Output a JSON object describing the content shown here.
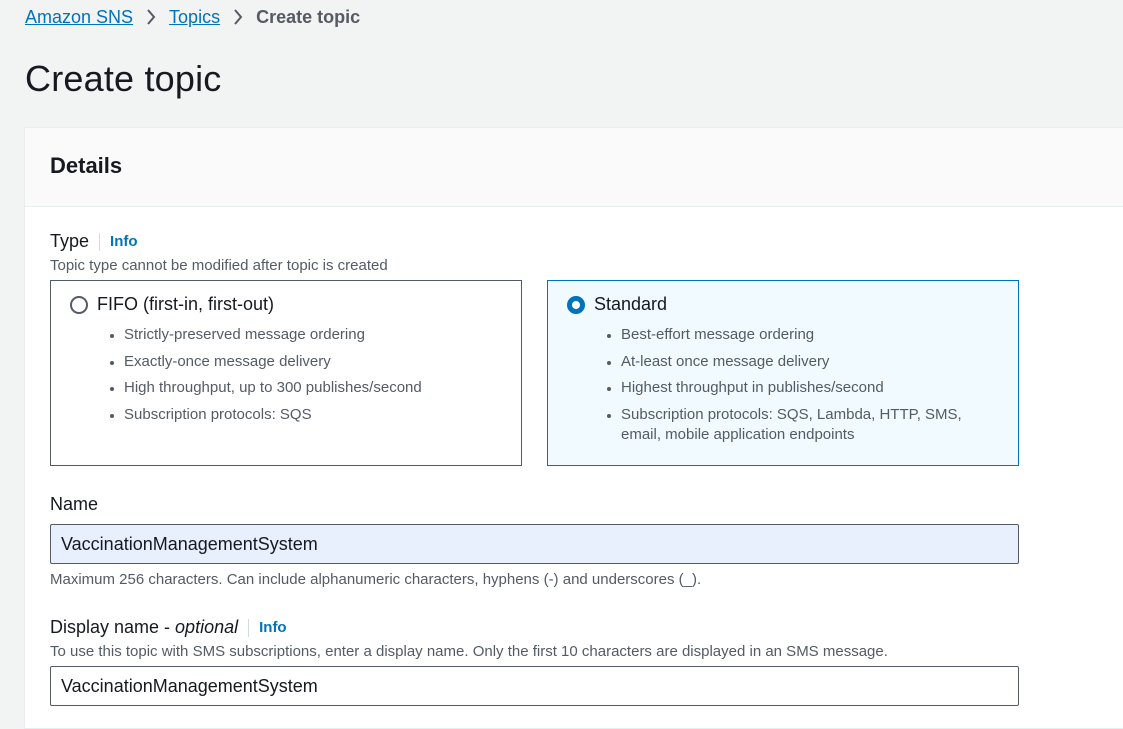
{
  "breadcrumb": {
    "items": [
      "Amazon SNS",
      "Topics"
    ],
    "current": "Create topic"
  },
  "page": {
    "title": "Create topic"
  },
  "details": {
    "heading": "Details",
    "type": {
      "label": "Type",
      "info": "Info",
      "description": "Topic type cannot be modified after topic is created",
      "options": [
        {
          "label": "FIFO (first-in, first-out)",
          "selected": false,
          "bullets": [
            "Strictly-preserved message ordering",
            "Exactly-once message delivery",
            "High throughput, up to 300 publishes/second",
            "Subscription protocols: SQS"
          ]
        },
        {
          "label": "Standard",
          "selected": true,
          "bullets": [
            "Best-effort message ordering",
            "At-least once message delivery",
            "Highest throughput in publishes/second",
            "Subscription protocols: SQS, Lambda, HTTP, SMS, email, mobile application endpoints"
          ]
        }
      ]
    },
    "name": {
      "label": "Name",
      "value": "VaccinationManagementSystem",
      "constraint": "Maximum 256 characters. Can include alphanumeric characters, hyphens (-) and underscores (_)."
    },
    "display_name": {
      "label": "Display name - ",
      "label_optional": "optional",
      "info": "Info",
      "description": "To use this topic with SMS subscriptions, enter a display name. Only the first 10 characters are displayed in an SMS message.",
      "value": "VaccinationManagementSystem"
    }
  },
  "colors": {
    "link": "#0073bb",
    "selected_border": "#0073bb",
    "selected_bg": "#f1faff",
    "autofill_bg": "#e8f0fe",
    "page_bg": "#f2f3f3"
  }
}
